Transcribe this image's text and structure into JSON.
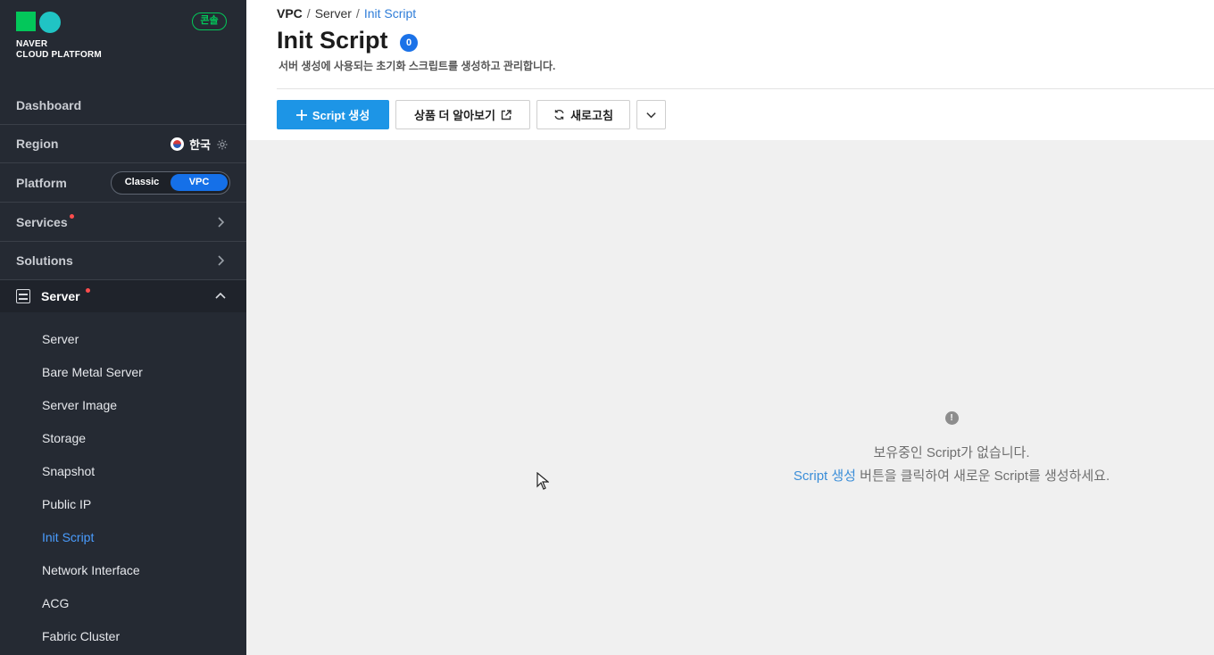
{
  "brand": {
    "logo_line1": "NAVER",
    "logo_line2": "CLOUD PLATFORM",
    "console_badge": "콘솔",
    "logo_colors": [
      "#03c75a",
      "#20c4c4"
    ]
  },
  "sidebar": {
    "dashboard_label": "Dashboard",
    "region_label": "Region",
    "region_value": "한국",
    "platform_label": "Platform",
    "platform_options": [
      "Classic",
      "VPC"
    ],
    "platform_selected": "VPC",
    "services_label": "Services",
    "solutions_label": "Solutions",
    "server_section_label": "Server",
    "server_items": [
      {
        "label": "Server"
      },
      {
        "label": "Bare Metal Server"
      },
      {
        "label": "Server Image"
      },
      {
        "label": "Storage"
      },
      {
        "label": "Snapshot"
      },
      {
        "label": "Public IP"
      },
      {
        "label": "Init Script"
      },
      {
        "label": "Network Interface"
      },
      {
        "label": "ACG"
      },
      {
        "label": "Fabric Cluster"
      }
    ],
    "active_item": "Init Script"
  },
  "breadcrumb": {
    "items": [
      "VPC",
      "Server",
      "Init Script"
    ],
    "separator": "/"
  },
  "page": {
    "title": "Init Script",
    "count": "0",
    "description": "서버 생성에 사용되는 초기화 스크립트를 생성하고 관리합니다."
  },
  "toolbar": {
    "create_label": "Script 생성",
    "learn_more_label": "상품 더 알아보기",
    "refresh_label": "새로고침"
  },
  "empty_state": {
    "icon": "!",
    "line1": "보유중인 Script가 없습니다.",
    "link_text": "Script 생성",
    "line2_rest": " 버튼을 클릭하여 새로운 Script를 생성하세요."
  },
  "colors": {
    "sidebar_bg": "#252a33",
    "accent_blue": "#1d95e6",
    "active_blue": "#4a9dff",
    "badge_blue": "#1b72e8",
    "alert_dot": "#ff4d4d"
  }
}
